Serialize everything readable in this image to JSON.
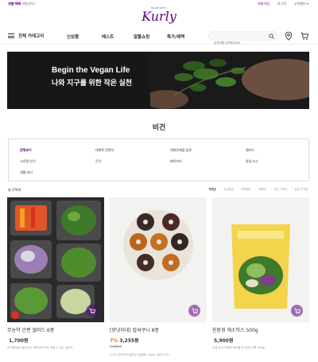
{
  "topbar": {
    "delivery_badge": "샛별·택배",
    "delivery_sub": "배송안내 ›",
    "links": [
      "회원가입",
      "로그인",
      "고객센터 ▾"
    ]
  },
  "logo": {
    "market": "MARKET",
    "brand": "Kurly"
  },
  "gnb": {
    "category_label": "전체 카테고리",
    "items": [
      "신상품",
      "베스트",
      "알뜰쇼핑",
      "특가/혜택"
    ],
    "search_placeholder": "검색어를 입력해주세요."
  },
  "icons": {
    "search": "search-icon",
    "location": "location-pin-icon",
    "cart": "cart-icon",
    "menu": "hamburger-icon"
  },
  "banner": {
    "title": "Begin the Vegan Life",
    "subtitle": "나와 지구를 위한 작은 실천"
  },
  "page_title": "비건",
  "categories": [
    "전체보기",
    "대체육·간편식",
    "대체유제품·음료",
    "샐러드",
    "시리얼·선식",
    "간식",
    "베이커리",
    "양념·소스",
    "생활·뷰티"
  ],
  "product_count": "총 378개",
  "sort_options": [
    "추천순",
    "신상품순",
    "판매량순",
    "혜택순",
    "낮은 가격순",
    "높은 가격순"
  ],
  "products": [
    {
      "name": "무농약 간편 샐러드 6종",
      "price": "1,700원",
      "discount": "",
      "original_price": "",
      "description": "내 마음대로 골라담고 세척되어 바로 먹을 수 있는 샐러드"
    },
    {
      "name": "[망넛이네] 잡싸쿠니 8종",
      "price": "3,255원",
      "discount": "7%",
      "original_price": "3,500원",
      "description": "누구나 편안하게 즐기는 잡쌀빵 (vegan 옵션 추가)"
    },
    {
      "name": "친환경 채소믹스 500g",
      "price": "5,900원",
      "discount": "",
      "original_price": "",
      "description": "손질 없이 다양한 채소를 한 번에 (1팩 500g)"
    }
  ],
  "colors": {
    "brand": "#5f0080",
    "discount": "#fa622f",
    "banner_bg": "#171717"
  }
}
